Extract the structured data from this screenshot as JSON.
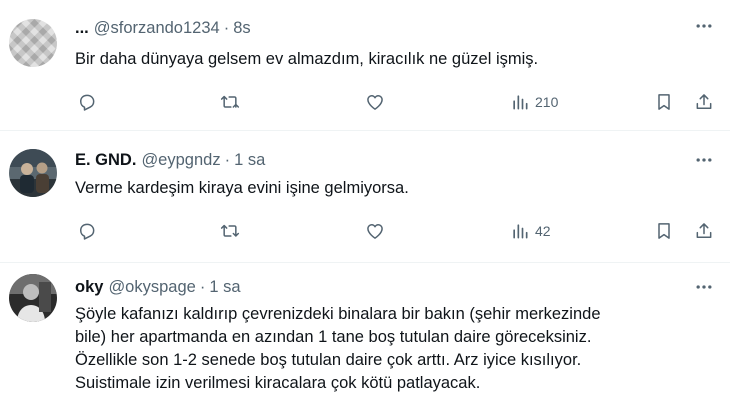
{
  "tweets": [
    {
      "name": "...",
      "handle": "@sforzando1234",
      "separator": "·",
      "time": "8s",
      "lines": [
        "Bir daha dünyaya gelsem ev almazdım, kiracılık ne güzel işmiş."
      ],
      "views": "210"
    },
    {
      "name": "E. GND.",
      "handle": "@eypgndz",
      "separator": "·",
      "time": "1 sa",
      "lines": [
        "Verme kardeşim kiraya evini işine gelmiyorsa."
      ],
      "views": "42"
    },
    {
      "name": "oky",
      "handle": "@okyspage",
      "separator": "·",
      "time": "1 sa",
      "lines": [
        "Şöyle kafanızı kaldırıp çevrenizdeki binalara bir bakın (şehir merkezinde",
        "bile) her apartmanda en azından 1 tane boş tutulan daire göreceksiniz.",
        "Özellikle son 1-2 senede boş tutulan daire çok arttı. Arz iyice kısılıyor.",
        "Suistimale izin verilmesi kiracalara çok kötü patlayacak."
      ]
    }
  ],
  "icons": {
    "reply": "reply-icon",
    "retweet": "retweet-icon",
    "like": "heart-icon",
    "views": "views-chart-icon",
    "bookmark": "bookmark-icon",
    "share": "share-icon",
    "more": "more-icon"
  },
  "colors": {
    "text": "#0f1419",
    "secondary": "#536471",
    "divider": "#eff3f4"
  }
}
